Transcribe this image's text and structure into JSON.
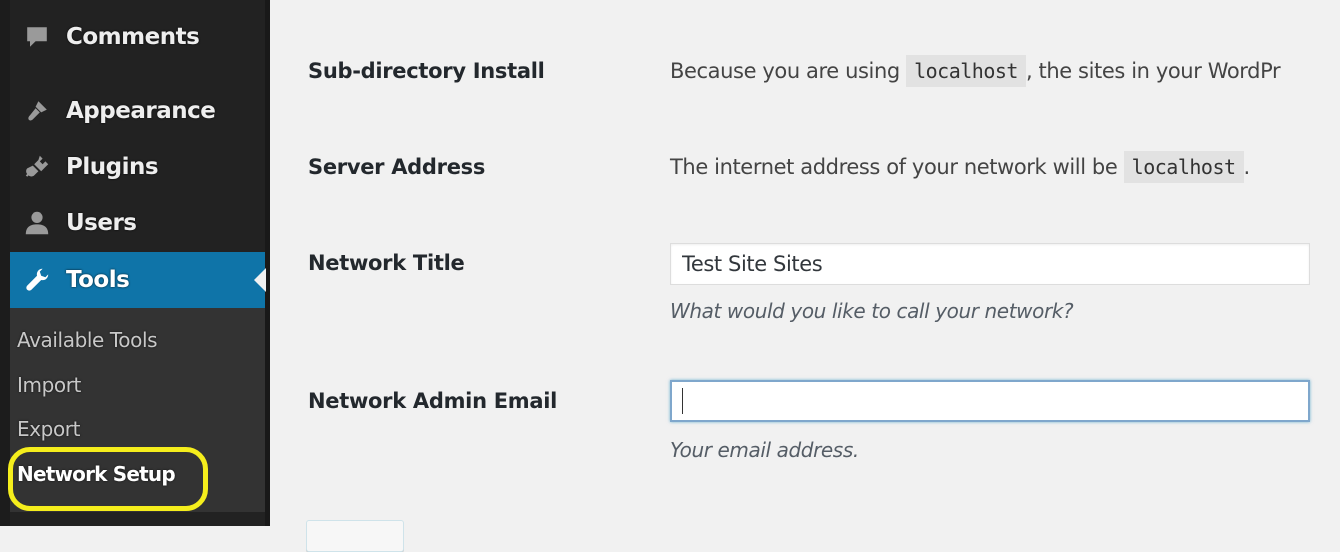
{
  "sidebar": {
    "menu": [
      {
        "label": "Comments",
        "icon": "comment-icon"
      },
      {
        "label": "Appearance",
        "icon": "paintbrush-icon"
      },
      {
        "label": "Plugins",
        "icon": "plugin-icon"
      },
      {
        "label": "Users",
        "icon": "user-icon"
      },
      {
        "label": "Tools",
        "icon": "wrench-icon",
        "current": true
      }
    ],
    "submenu": [
      {
        "label": "Available Tools"
      },
      {
        "label": "Import"
      },
      {
        "label": "Export"
      },
      {
        "label": "Network Setup",
        "active": true
      }
    ],
    "colors": {
      "background": "#222222",
      "current_item": "#0f74a8",
      "submenu_background": "#333333",
      "highlight_ring": "#f5ee1c"
    }
  },
  "form": {
    "sub_directory": {
      "label": "Sub-directory Install",
      "text_before": "Because you are using ",
      "code": "localhost",
      "text_after": ", the sites in your WordPr"
    },
    "server_address": {
      "label": "Server Address",
      "text_before": "The internet address of your network will be ",
      "code": "localhost",
      "text_after": "."
    },
    "network_title": {
      "label": "Network Title",
      "value": "Test Site Sites",
      "description": "What would you like to call your network?"
    },
    "admin_email": {
      "label": "Network Admin Email",
      "value": "",
      "description": "Your email address."
    }
  }
}
